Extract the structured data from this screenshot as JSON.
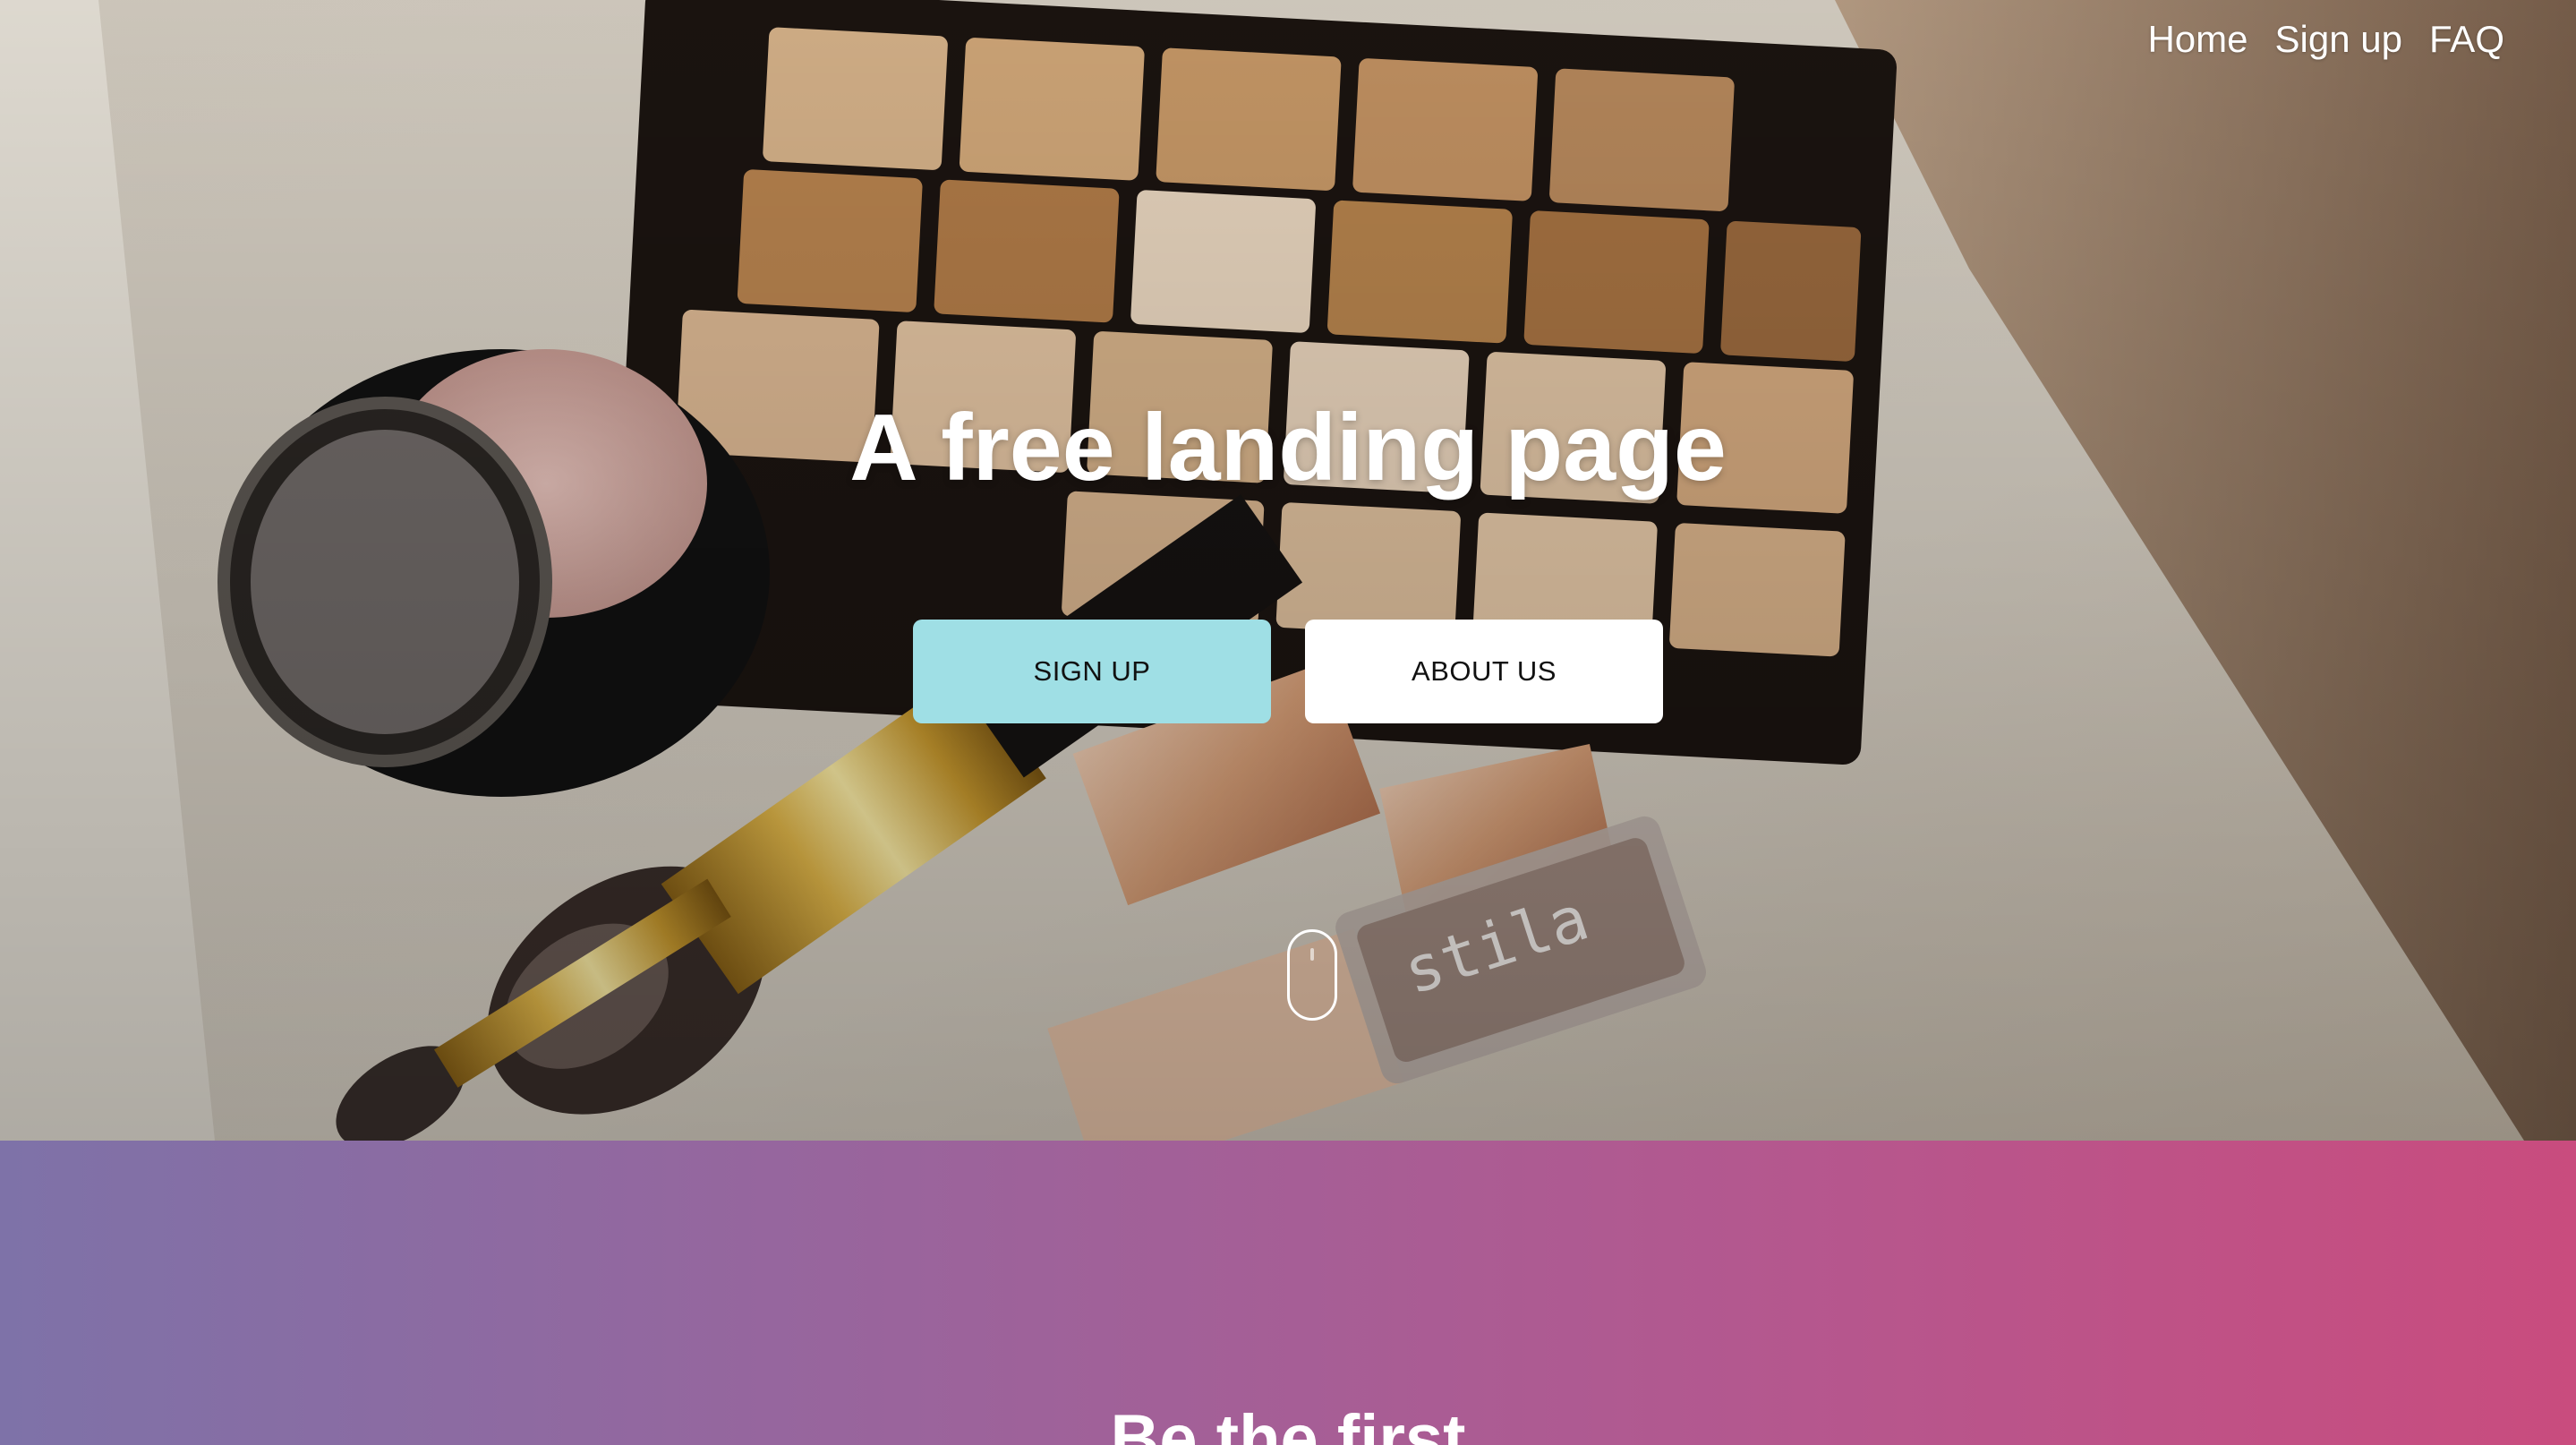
{
  "nav": {
    "items": [
      "Home",
      "Sign up",
      "FAQ"
    ]
  },
  "hero": {
    "title": "A free landing page",
    "primary_button": "SIGN UP",
    "secondary_button": "ABOUT US",
    "palette_brand_text": "stila"
  },
  "section_two": {
    "title": "Be the first"
  },
  "colors": {
    "primary_button": "#9fdfe5",
    "secondary_button": "#ffffff",
    "gradient_start": "#7e72a8",
    "gradient_end": "#c94c7e"
  },
  "icons": {
    "scroll_indicator": "mouse-scroll-icon"
  }
}
